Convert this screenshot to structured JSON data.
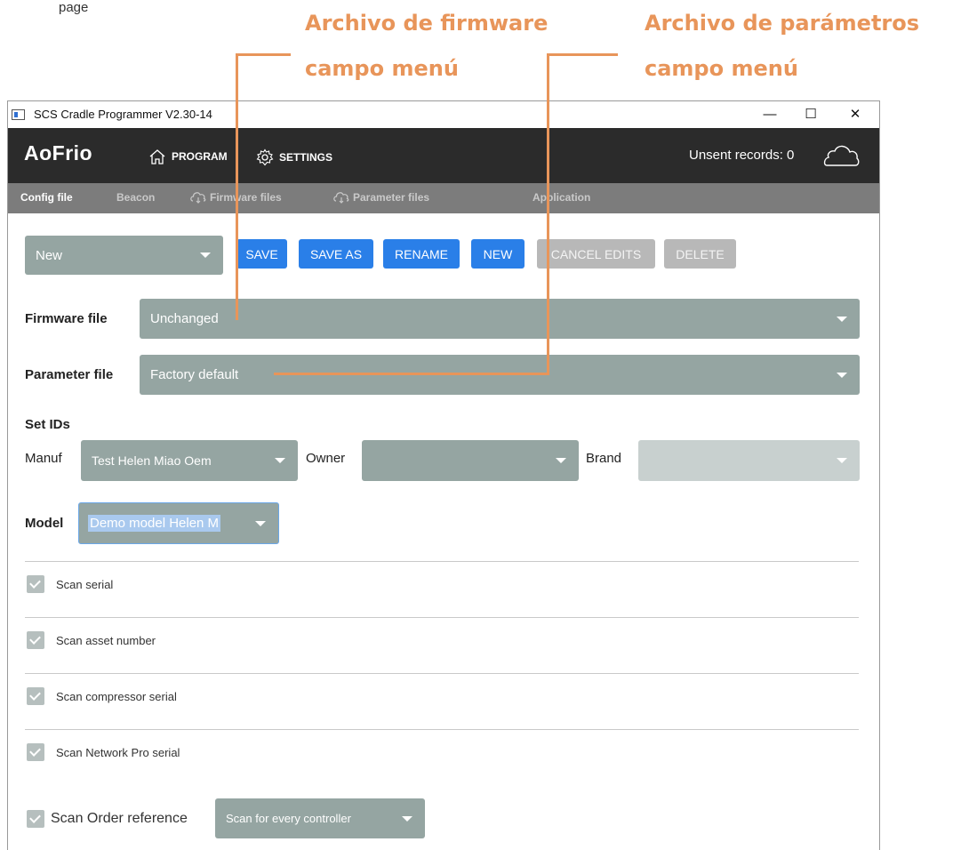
{
  "page_snippet": "page",
  "callouts": {
    "firmware_line1": "Archivo de firmware",
    "firmware_line2": "campo menú",
    "parameter_line1": "Archivo de parámetros",
    "parameter_line2": "campo menú"
  },
  "window": {
    "title": "SCS Cradle Programmer V2.30-14",
    "minimize": "—",
    "maximize": "☐",
    "close": "✕"
  },
  "navbar": {
    "logo": "AoFrio",
    "program_label": "PROGRAM",
    "settings_label": "SETTINGS",
    "unsent_records": "Unsent records: 0",
    "cloud_icon": "cloud-icon"
  },
  "subnav": {
    "tabs": [
      {
        "label": "Config file",
        "active": true
      },
      {
        "label": "Beacon",
        "active": false
      },
      {
        "label": "Firmware files",
        "active": false
      },
      {
        "label": "Parameter files",
        "active": false
      },
      {
        "label": "Application",
        "active": false
      }
    ]
  },
  "config": {
    "selected_config": "New",
    "buttons": {
      "save": "SAVE",
      "save_as": "SAVE AS",
      "rename": "RENAME",
      "new": "NEW",
      "cancel_edits": "CANCEL EDITS",
      "delete": "DELETE"
    },
    "firmware_label": "Firmware file",
    "firmware_value": "Unchanged",
    "parameter_label": "Parameter file",
    "parameter_value": "Factory default",
    "set_ids_label": "Set IDs",
    "manuf_label": "Manuf",
    "manuf_value": "Test Helen Miao Oem",
    "owner_label": "Owner",
    "owner_value": "",
    "brand_label": "Brand",
    "brand_value": "",
    "model_label": "Model",
    "model_value": "Demo model Helen M"
  },
  "scan_options": [
    {
      "label": "Scan serial",
      "checked": true
    },
    {
      "label": "Scan asset number",
      "checked": true
    },
    {
      "label": "Scan compressor serial",
      "checked": true
    },
    {
      "label": "Scan Network Pro serial",
      "checked": true
    }
  ],
  "scan_order": {
    "label": "Scan Order reference",
    "checked": true,
    "value": "Scan for every controller"
  },
  "colors": {
    "accent_orange": "#e8955a",
    "primary_button": "#2a7fe8",
    "dropdown_bg": "#95a5a2",
    "navbar_bg": "#2b2b2b"
  }
}
